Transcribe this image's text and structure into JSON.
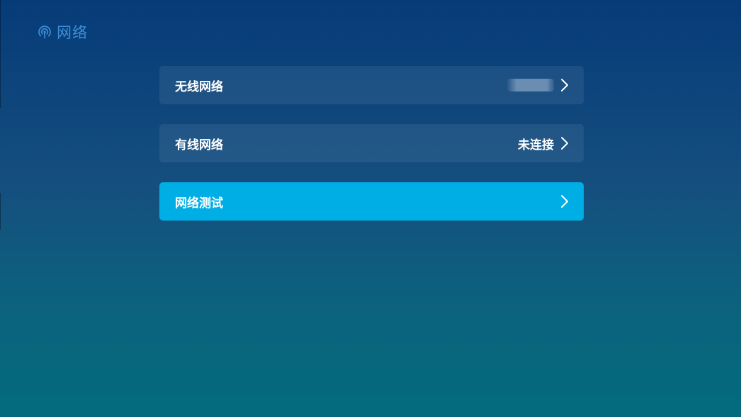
{
  "header": {
    "icon": "network-signal-icon",
    "title": "网络"
  },
  "menu": {
    "items": [
      {
        "label": "无线网络",
        "value": "",
        "value_redacted": true,
        "icon": "chevron-right-icon",
        "focused": false
      },
      {
        "label": "有线网络",
        "value": "未连接",
        "value_redacted": false,
        "icon": "chevron-right-icon",
        "focused": false
      },
      {
        "label": "网络测试",
        "value": "",
        "value_redacted": false,
        "icon": "chevron-right-icon",
        "focused": true
      }
    ]
  },
  "colors": {
    "header_accent": "#3d8fd9",
    "focus_highlight": "#00aee6",
    "text": "#ffffff"
  }
}
